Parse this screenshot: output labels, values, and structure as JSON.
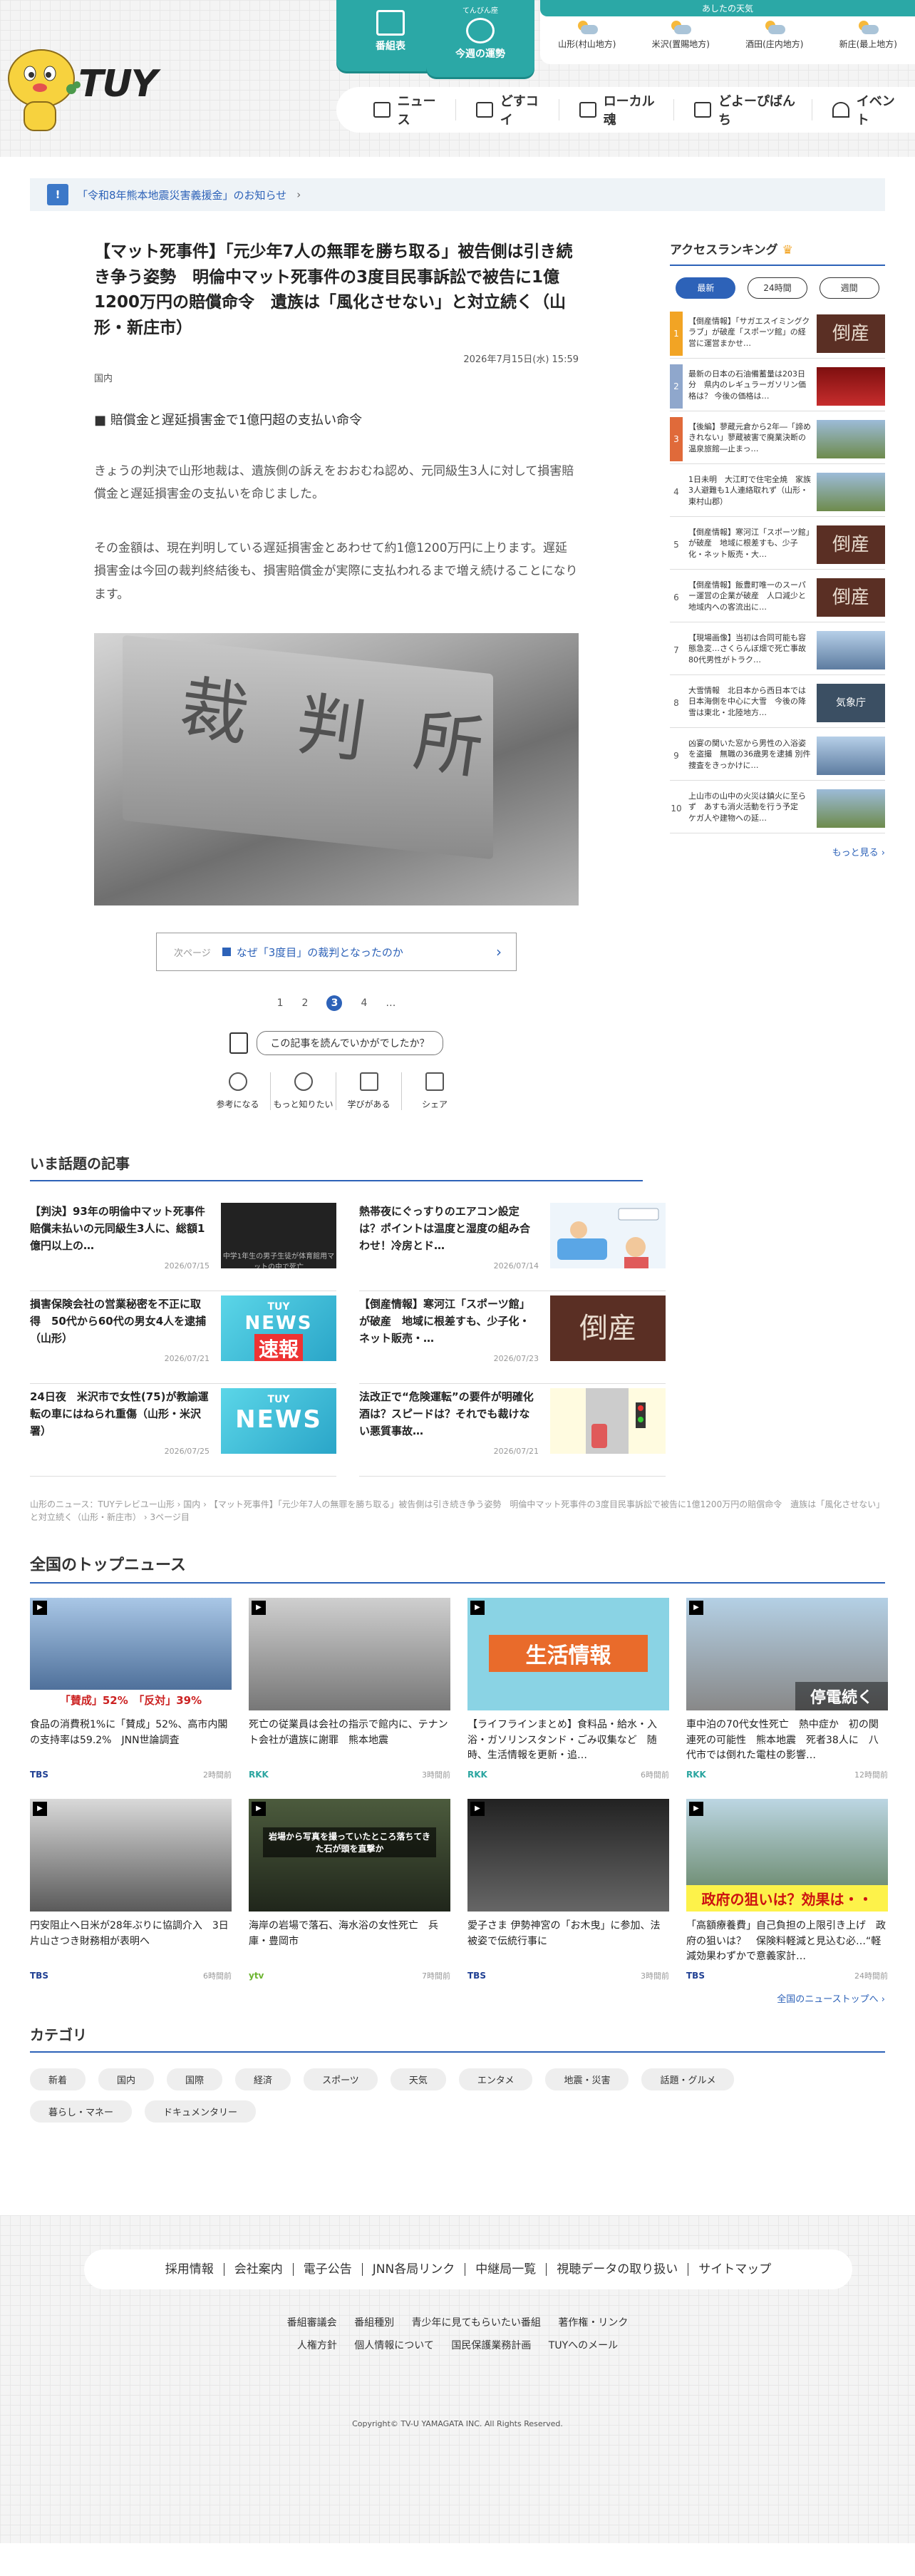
{
  "header": {
    "logo_text": "TUY",
    "program_label": "番組表",
    "fortune_small": "てんびん座",
    "fortune_label": "今週の運勢",
    "weather_heading": "あしたの天気",
    "weather": [
      {
        "area": "山形(村山地方)",
        "icon": "sun-cloud-icon"
      },
      {
        "area": "米沢(置賜地方)",
        "icon": "sun-cloud-icon"
      },
      {
        "area": "酒田(庄内地方)",
        "icon": "sun-cloud-icon"
      },
      {
        "area": "新庄(最上地方)",
        "icon": "sun-cloud-icon"
      }
    ],
    "nav": [
      "ニュース",
      "どすコイ",
      "ローカル魂",
      "どよーぴばんち",
      "イベント"
    ]
  },
  "notice": {
    "text": "「令和8年熊本地震災害義援金」のお知らせ"
  },
  "article": {
    "title": "【マット死事件】「元少年7人の無罪を勝ち取る」被告側は引き続き争う姿勢　明倫中マット死事件の3度目民事訴訟で被告に1億1200万円の賠償命令　遺族は「風化させない」と対立続く（山形・新庄市）",
    "date": "2026年7月15日(水) 15:59",
    "category": "国内",
    "subhead": "■ 賠償金と遅延損害金で1億円超の支払い命令",
    "para1": "きょうの判決で山形地裁は、遺族側の訴えをおおむね認め、元同級生3人に対して損害賠償金と遅延損害金の支払いを命じました。",
    "para2": "その金額は、現在判明している遅延損害金とあわせて約1億1200万円に上ります。遅延損害金は今回の裁判終結後も、損害賠償金が実際に支払われるまで増え続けることになります。",
    "photo_text": "裁判所",
    "next_label": "次ページ",
    "next_title": "なぜ「3度目」の裁判となったのか",
    "pages": [
      "1",
      "2",
      "3",
      "4",
      "…"
    ],
    "feedback": "この記事を読んでいかがでしたか？",
    "reactions": [
      "参考になる",
      "もっと知りたい",
      "学びがある",
      "シェア"
    ]
  },
  "ranking": {
    "title": "アクセスランキング",
    "tabs": [
      "最新",
      "24時間",
      "週間"
    ],
    "items": [
      {
        "n": "1",
        "text": "【倒産情報】「サガエスイミングクラブ」が破産「スポーツ館」の経営に運営まかせ…",
        "thumb": "倒産"
      },
      {
        "n": "2",
        "text": "最新の日本の石油備蓄量は203日分　県内のレギュラーガソリン価格は？ 今後の価格は…",
        "thumb": ""
      },
      {
        "n": "3",
        "text": "【後編】蓼蔵元倉から2年―「諦めきれない」蓼蔵被害で廃業決断の温泉旅館―止まっ…",
        "thumb": ""
      },
      {
        "n": "4",
        "text": "1日未明　大江町で住宅全焼　家族3人避難も1人連絡取れず（山形・東村山郡）",
        "thumb": ""
      },
      {
        "n": "5",
        "text": "【倒産情報】寒河江「スポーツ館」が破産　地域に根差すも、少子化・ネット販売・大…",
        "thumb": "倒産"
      },
      {
        "n": "6",
        "text": "【倒産情報】飯豊町唯一のスーパー運営の企業が破産　人口減少と地域内への客流出に…",
        "thumb": "倒産"
      },
      {
        "n": "7",
        "text": "【現場画像】当初は合同可能も容態急変…さくらんぼ畑で死亡事故　80代男性がトラク…",
        "thumb": ""
      },
      {
        "n": "8",
        "text": "大雪情報　北日本から西日本では日本海側を中心に大雪　今後の降雪は東北・北陸地方…",
        "thumb": "気象庁"
      },
      {
        "n": "9",
        "text": "凶宴の関いた窓から男性の入浴姿を盗撮　無職の36歳男を逮捕 別件捜査をきっかけに…",
        "thumb": ""
      },
      {
        "n": "10",
        "text": "上山市の山中の火災は鎮火に至らず　あすも消火活動を行う予定　ケガ人や建物への延…",
        "thumb": ""
      }
    ],
    "more": "もっと見る"
  },
  "popular": {
    "title": "いま話題の記事",
    "items": [
      {
        "title": "【判決】93年の明倫中マット死事件　賠償未払いの元同級生3人に、総額1億円以上の…",
        "date": "2026/07/15",
        "img": "dark",
        "cap": "中学1年生の男子生徒が体育館用マットの中で死亡"
      },
      {
        "title": "熱帯夜にぐっすりのエアコン設定は？ポイントは温度と湿度の組み合わせ！冷房とド…",
        "date": "2026/07/14",
        "img": "illus",
        "cap": ""
      },
      {
        "title": "損害保険会社の営業秘密を不正に取得　50代から60代の男女4人を逮捕（山形）",
        "date": "2026/07/21",
        "img": "news",
        "cap": "速報"
      },
      {
        "title": "【倒産情報】寒河江「スポーツ館」が破産　地域に根差すも、少子化・ネット販売・…",
        "date": "2026/07/23",
        "img": "tou",
        "cap": "倒産"
      },
      {
        "title": "24日夜　米沢市で女性(75)が教諭運転の車にはねられ重傷（山形・米沢署）",
        "date": "2026/07/25",
        "img": "news",
        "cap": "NEWS"
      },
      {
        "title": "法改正で“危険運転”の要件が明確化　酒は？スピードは？それでも裁けない悪質事故…",
        "date": "2026/07/21",
        "img": "car",
        "cap": ""
      }
    ],
    "news_logo": "TUY",
    "news_word": "NEWS"
  },
  "breadcrumb": [
    "山形のニュース：TUYテレビユー山形",
    "国内",
    "【マット死事件】「元少年7人の無罪を勝ち取る」被告側は引き続き争う姿勢　明倫中マット死事件の3度目民事訴訟で被告に1億1200万円の賠償命令　遺族は「風化させない」と対立続く（山形・新庄市）",
    "3ページ目"
  ],
  "topnews": {
    "title": "全国のトップニュース",
    "items": [
      {
        "title": "食品の消費税1%に「賛成」52%、高市内閣の支持率は59.2%　JNN世論調査",
        "source": "TBS",
        "time": "2時間前",
        "ovl": "「賛成」52%　「反対」39%"
      },
      {
        "title": "死亡の従業員は会社の指示で館内に、テナント会社が遺族に謝罪　熊本地震",
        "source": "RKK",
        "time": "3時間前",
        "ovl": ""
      },
      {
        "title": "【ライフラインまとめ】食料品・給水・入浴・ガソリンスタンド・ごみ収集など　随時、生活情報を更新・追…",
        "source": "RKK",
        "time": "6時間前",
        "ovl": "生活情報"
      },
      {
        "title": "車中泊の70代女性死亡　熱中症か　初の関連死の可能性　熊本地震　死者38人に　八代市では倒れた電柱の影響…",
        "source": "RKK",
        "time": "12時間前",
        "ovl": "停電続く"
      },
      {
        "title": "円安阻止へ日米が28年ぶりに協調介入　3日 片山さつき財務相が表明へ",
        "source": "TBS",
        "time": "6時間前",
        "ovl": ""
      },
      {
        "title": "海岸の岩場で落石、海水浴の女性死亡　兵庫・豊岡市",
        "source": "ytv",
        "time": "7時間前",
        "ovl": "岩場から写真を撮っていたところ落ちてきた石が頭を直撃か"
      },
      {
        "title": "愛子さま 伊勢神宮の「お木曳」に参加、法被姿で伝統行事に",
        "source": "TBS",
        "time": "3時間前",
        "ovl": ""
      },
      {
        "title": "「高額療養費」自己負担の上限引き上げ　政府の狙いは？　保険料軽減と見込む必…“軽減効果わずかで意義家計…",
        "source": "TBS",
        "time": "24時間前",
        "ovl": "政府の狙いは？効果は・・"
      }
    ],
    "more": "全国のニューストップへ"
  },
  "categories": {
    "title": "カテゴリ",
    "items": [
      "新着",
      "国内",
      "国際",
      "経済",
      "スポーツ",
      "天気",
      "エンタメ",
      "地震・災害",
      "話題・グルメ",
      "暮らし・マネー",
      "ドキュメンタリー"
    ]
  },
  "footer": {
    "links": [
      "採用情報",
      "会社案内",
      "電子公告",
      "JNN各局リンク",
      "中継局一覧",
      "視聴データの取り扱い",
      "サイトマップ"
    ],
    "row1": [
      "番組審議会",
      "番組種別",
      "青少年に見てもらいたい番組",
      "著作権・リンク"
    ],
    "row2": [
      "人権方針",
      "個人情報について",
      "国民保護業務計画",
      "TUYへのメール"
    ],
    "copyright": "Copyright© TV-U YAMAGATA INC. All Rights Reserved."
  },
  "colors": {
    "teal": "#2ba8a6",
    "blue": "#2d62b8",
    "accent": "#f2a424"
  }
}
